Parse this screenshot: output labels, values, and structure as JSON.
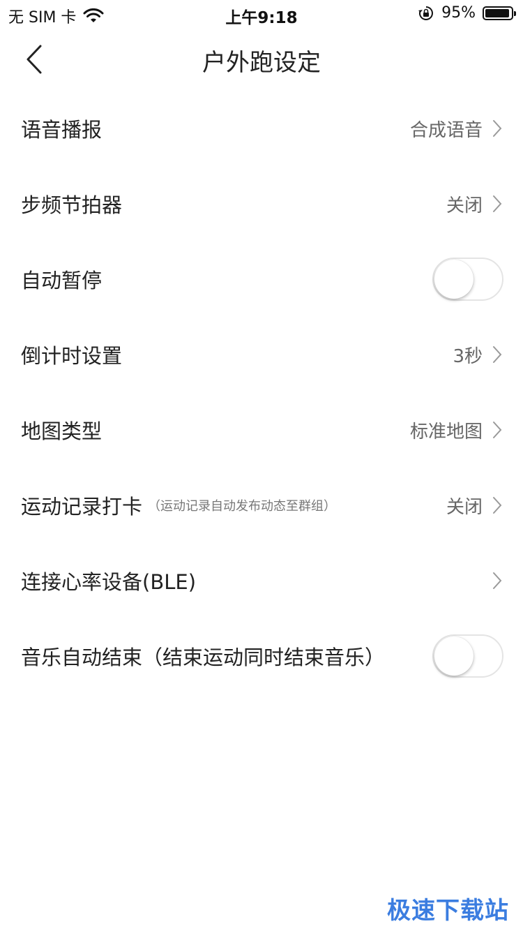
{
  "status_bar": {
    "carrier": "无 SIM 卡",
    "time": "上午9:18",
    "battery_percent": "95%",
    "battery_level": 0.95,
    "icons": [
      "wifi-icon",
      "rotation-lock-icon",
      "battery-icon"
    ]
  },
  "nav": {
    "title": "户外跑设定",
    "back_icon": "chevron-left-icon"
  },
  "settings": [
    {
      "label": "语音播报",
      "value": "合成语音",
      "type": "link"
    },
    {
      "label": "步频节拍器",
      "value": "关闭",
      "type": "link"
    },
    {
      "label": "自动暂停",
      "type": "toggle",
      "on": false
    },
    {
      "label": "倒计时设置",
      "value": "3秒",
      "type": "link"
    },
    {
      "label": "地图类型",
      "value": "标准地图",
      "type": "link"
    },
    {
      "label": "运动记录打卡",
      "sublabel": "（运动记录自动发布动态至群组）",
      "value": "关闭",
      "type": "link"
    },
    {
      "label": "连接心率设备(BLE)",
      "value": "",
      "type": "link"
    },
    {
      "label": "音乐自动结束（结束运动同时结束音乐）",
      "type": "toggle",
      "on": false
    }
  ],
  "watermark": "极速下载站",
  "colors": {
    "background": "#ffffff",
    "text_primary": "#222222",
    "text_secondary": "#666666",
    "watermark": "#3b7de0"
  }
}
